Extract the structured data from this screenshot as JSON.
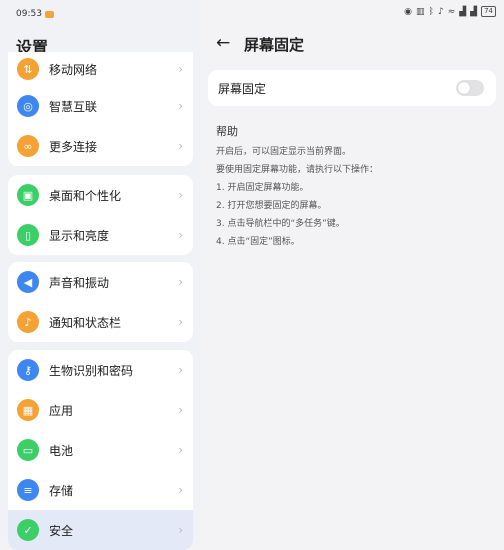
{
  "status_bar": {
    "time": "09:53",
    "battery": "74"
  },
  "left": {
    "title": "设置",
    "groups": [
      [
        {
          "name": "mobile-network",
          "label": "移动网络",
          "icon": "signal-icon",
          "color": "#f3a233",
          "glyph": "⇅"
        },
        {
          "name": "smart-connect",
          "label": "智慧互联",
          "icon": "target-icon",
          "color": "#3f87f0",
          "glyph": "◎"
        },
        {
          "name": "more-connections",
          "label": "更多连接",
          "icon": "link-icon",
          "color": "#f3a233",
          "glyph": "∞"
        }
      ],
      [
        {
          "name": "desktop-personalization",
          "label": "桌面和个性化",
          "icon": "picture-icon",
          "color": "#3ccf68",
          "glyph": "▣"
        },
        {
          "name": "display-brightness",
          "label": "显示和亮度",
          "icon": "phone-icon",
          "color": "#3ccf68",
          "glyph": "▯"
        }
      ],
      [
        {
          "name": "sound-vibration",
          "label": "声音和振动",
          "icon": "speaker-icon",
          "color": "#3f87f0",
          "glyph": "◀"
        },
        {
          "name": "notifications-statusbar",
          "label": "通知和状态栏",
          "icon": "bell-icon",
          "color": "#f3a233",
          "glyph": "♪"
        }
      ],
      [
        {
          "name": "biometrics-password",
          "label": "生物识别和密码",
          "icon": "key-icon",
          "color": "#3f87f0",
          "glyph": "⚷"
        },
        {
          "name": "apps",
          "label": "应用",
          "icon": "grid-icon",
          "color": "#f3a233",
          "glyph": "▦"
        },
        {
          "name": "battery",
          "label": "电池",
          "icon": "battery-icon",
          "color": "#3ccf68",
          "glyph": "▭"
        },
        {
          "name": "storage",
          "label": "存储",
          "icon": "database-icon",
          "color": "#3f87f0",
          "glyph": "≡"
        },
        {
          "name": "security",
          "label": "安全",
          "icon": "shield-icon",
          "color": "#3ccf68",
          "glyph": "✓",
          "active": true
        }
      ]
    ]
  },
  "right": {
    "title": "屏幕固定",
    "toggle_label": "屏幕固定",
    "toggle_on": false,
    "help_title": "帮助",
    "help_lines": [
      "开启后，可以固定显示当前界面。",
      "要使用固定屏幕功能，请执行以下操作：",
      "1. 开启固定屏幕功能。",
      "2. 打开您想要固定的屏幕。",
      "3. 点击导航栏中的“多任务”键。",
      "4. 点击“固定”图标。"
    ]
  }
}
